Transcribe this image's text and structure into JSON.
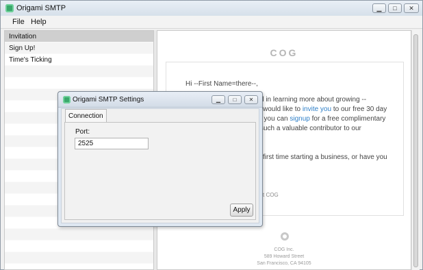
{
  "window": {
    "title": "Origami SMTP",
    "controls": {
      "minimize": "▁",
      "maximize": "□",
      "close": "✕"
    }
  },
  "menu": [
    {
      "label": "File"
    },
    {
      "label": "Help"
    }
  ],
  "sidebar": {
    "items": [
      {
        "label": "Invitation",
        "selected": true
      },
      {
        "label": "Sign Up!",
        "selected": false
      },
      {
        "label": "Time's Ticking",
        "selected": false
      }
    ]
  },
  "preview": {
    "logo": "COG",
    "greeting": "Hi --First Name=there--,",
    "lines": [
      "d in learning more about growing --",
      "l would like to ",
      "invite you",
      " to our free 30 day",
      ", you can ",
      "signup",
      " for a free complimentary",
      " such a valuable contributor to our",
      "first time starting a business, or have you",
      "t COG"
    ],
    "footer": {
      "company": "COG Inc.",
      "street": "589 Howard Street",
      "city": "San Francisco, CA 94105"
    }
  },
  "dialog": {
    "title": "Origami SMTP Settings",
    "tab": "Connection",
    "port_label": "Port:",
    "port_value": "2525",
    "apply_label": "Apply"
  },
  "colors": {
    "link": "#2e7fc8",
    "accent_icon": "#3aa86c"
  }
}
